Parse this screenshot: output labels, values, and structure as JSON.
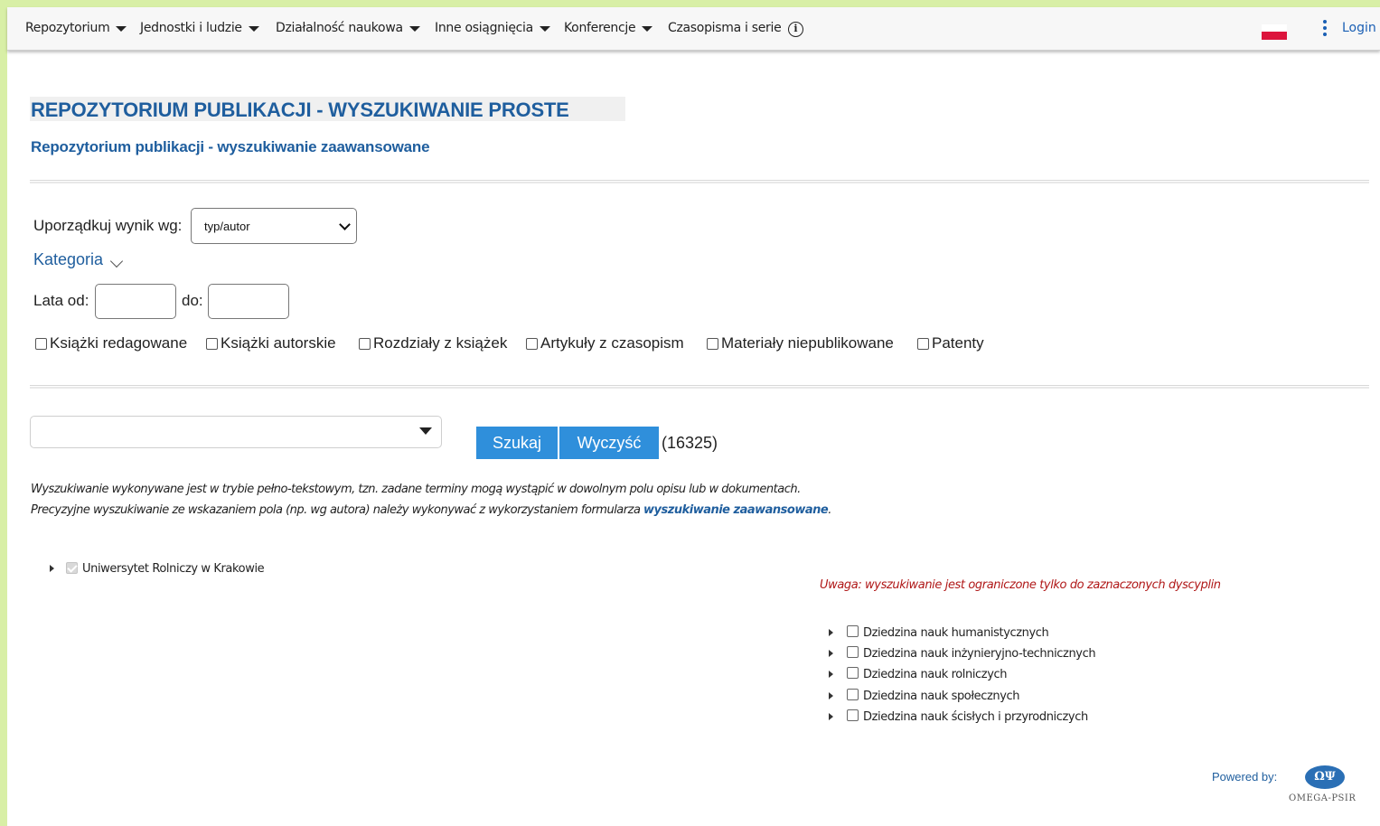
{
  "nav": {
    "items": [
      {
        "label": "Repozytorium",
        "has_caret": true
      },
      {
        "label": "Jednostki i ludzie",
        "has_caret": true
      },
      {
        "label": "Działalność naukowa",
        "has_caret": true
      },
      {
        "label": "Inne osiągnięcia",
        "has_caret": true
      },
      {
        "label": "Konferencje",
        "has_caret": true
      },
      {
        "label": "Czasopisma i serie",
        "has_caret": false
      }
    ],
    "info_icon": "info-icon",
    "info_symbol": "i",
    "login_label": "Login",
    "language_flag": "flag-pl-icon"
  },
  "header": {
    "title": "REPOZYTORIUM PUBLIKACJI - WYSZUKIWANIE PROSTE",
    "advanced_link": "Repozytorium publikacji - wyszukiwanie zaawansowane"
  },
  "filters": {
    "order_label": "Uporządkuj wynik wg:",
    "order_value": "typ/autor",
    "category_label": "Kategoria",
    "years_from_label": "Lata od:",
    "years_to_label": "do:",
    "types": [
      {
        "label": "Książki redagowane",
        "checked": false
      },
      {
        "label": "Książki autorskie",
        "checked": false
      },
      {
        "label": "Rozdziały z książek",
        "checked": false
      },
      {
        "label": "Artykuły z czasopism",
        "checked": false
      },
      {
        "label": "Materiały niepublikowane",
        "checked": false
      },
      {
        "label": "Patenty",
        "checked": false
      }
    ]
  },
  "search": {
    "search_button": "Szukaj",
    "clear_button": "Wyczyść",
    "count": "(16325)"
  },
  "notes": {
    "line1": "Wyszukiwanie wykonywane jest w trybie pełno-tekstowym, tzn. zadane terminy mogą wystąpić w dowolnym polu opisu lub w dokumentach.",
    "line2_prefix": "Precyzyjne wyszukiwanie ze wskazaniem pola (np. wg autora) należy wykonywać z wykorzystaniem formularza ",
    "line2_link": "wyszukiwanie zaawansowane",
    "line2_suffix": "."
  },
  "units_tree": {
    "root": {
      "label": "Uniwersytet Rolniczy w Krakowie",
      "checked": true
    }
  },
  "disciplines": {
    "warning": "Uwaga: wyszukiwanie jest ograniczone tylko do zaznaczonych dyscyplin",
    "items": [
      {
        "label": "Dziedzina nauk humanistycznych",
        "checked": false
      },
      {
        "label": "Dziedzina nauk inżynieryjno-technicznych",
        "checked": false
      },
      {
        "label": "Dziedzina nauk rolniczych",
        "checked": false
      },
      {
        "label": "Dziedzina nauk społecznych",
        "checked": false
      },
      {
        "label": "Dziedzina nauk ścisłych i przyrodniczych",
        "checked": false
      }
    ]
  },
  "footer": {
    "powered_by": "Powered by:",
    "logo_text": "OMEGA-PSIR",
    "logo_mark": "ΩΨ"
  },
  "colors": {
    "accent": "#1f5e9e",
    "button": "#2f8fdb",
    "warning": "#b01818",
    "frame": "#d8efa6"
  }
}
